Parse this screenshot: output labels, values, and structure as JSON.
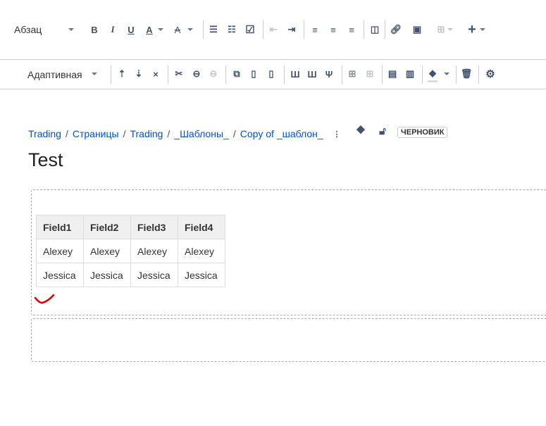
{
  "toolbar": {
    "paragraph_style": "Абзац",
    "table_width": "Адаптивная"
  },
  "breadcrumb": [
    "Trading",
    "Страницы",
    "Trading",
    "_Шаблоны_",
    "Copy of _шаблон_"
  ],
  "status_badge": "ЧЕРНОВИК",
  "page_title": "Test",
  "table": {
    "headers": [
      "Field1",
      "Field2",
      "Field3",
      "Field4"
    ],
    "rows": [
      [
        "Alexey",
        "Alexey",
        "Alexey",
        "Alexey"
      ],
      [
        "Jessica",
        "Jessica",
        "Jessica",
        "Jessica"
      ]
    ]
  },
  "colors": {
    "link": "#0052cc",
    "icon": "#42526e",
    "annotation": "#e00000"
  }
}
